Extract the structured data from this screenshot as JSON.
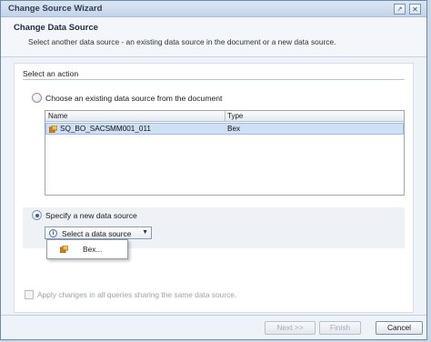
{
  "window": {
    "title": "Change Source Wizard",
    "help_icon": "help-icon",
    "close_icon": "close-icon"
  },
  "header": {
    "title": "Change Data Source",
    "description": "Select another data source - an existing data source in the document or a new data source."
  },
  "action_section": {
    "label": "Select an action"
  },
  "option_existing": {
    "label": "Choose an existing data source from the document",
    "selected": false,
    "table": {
      "columns": [
        "Name",
        "Type"
      ],
      "rows": [
        {
          "name": "SQ_BO_SACSMM001_011",
          "type": "Bex",
          "icon": "bex-source-icon",
          "selected": true
        }
      ]
    }
  },
  "option_new": {
    "label": "Specify a new data source",
    "selected": true,
    "combo": {
      "label": "Select a data source",
      "icon": "info-icon"
    },
    "dropdown_items": [
      {
        "label": "Bex...",
        "icon": "bex-source-icon"
      }
    ]
  },
  "apply_checkbox": {
    "label": "Apply changes in all queries sharing the same data source.",
    "checked": false,
    "enabled": false
  },
  "buttons": {
    "next": "Next >>",
    "finish": "Finish",
    "cancel": "Cancel"
  },
  "colors": {
    "accent": "#3b5f8f",
    "selection": "#cfe0f5"
  }
}
